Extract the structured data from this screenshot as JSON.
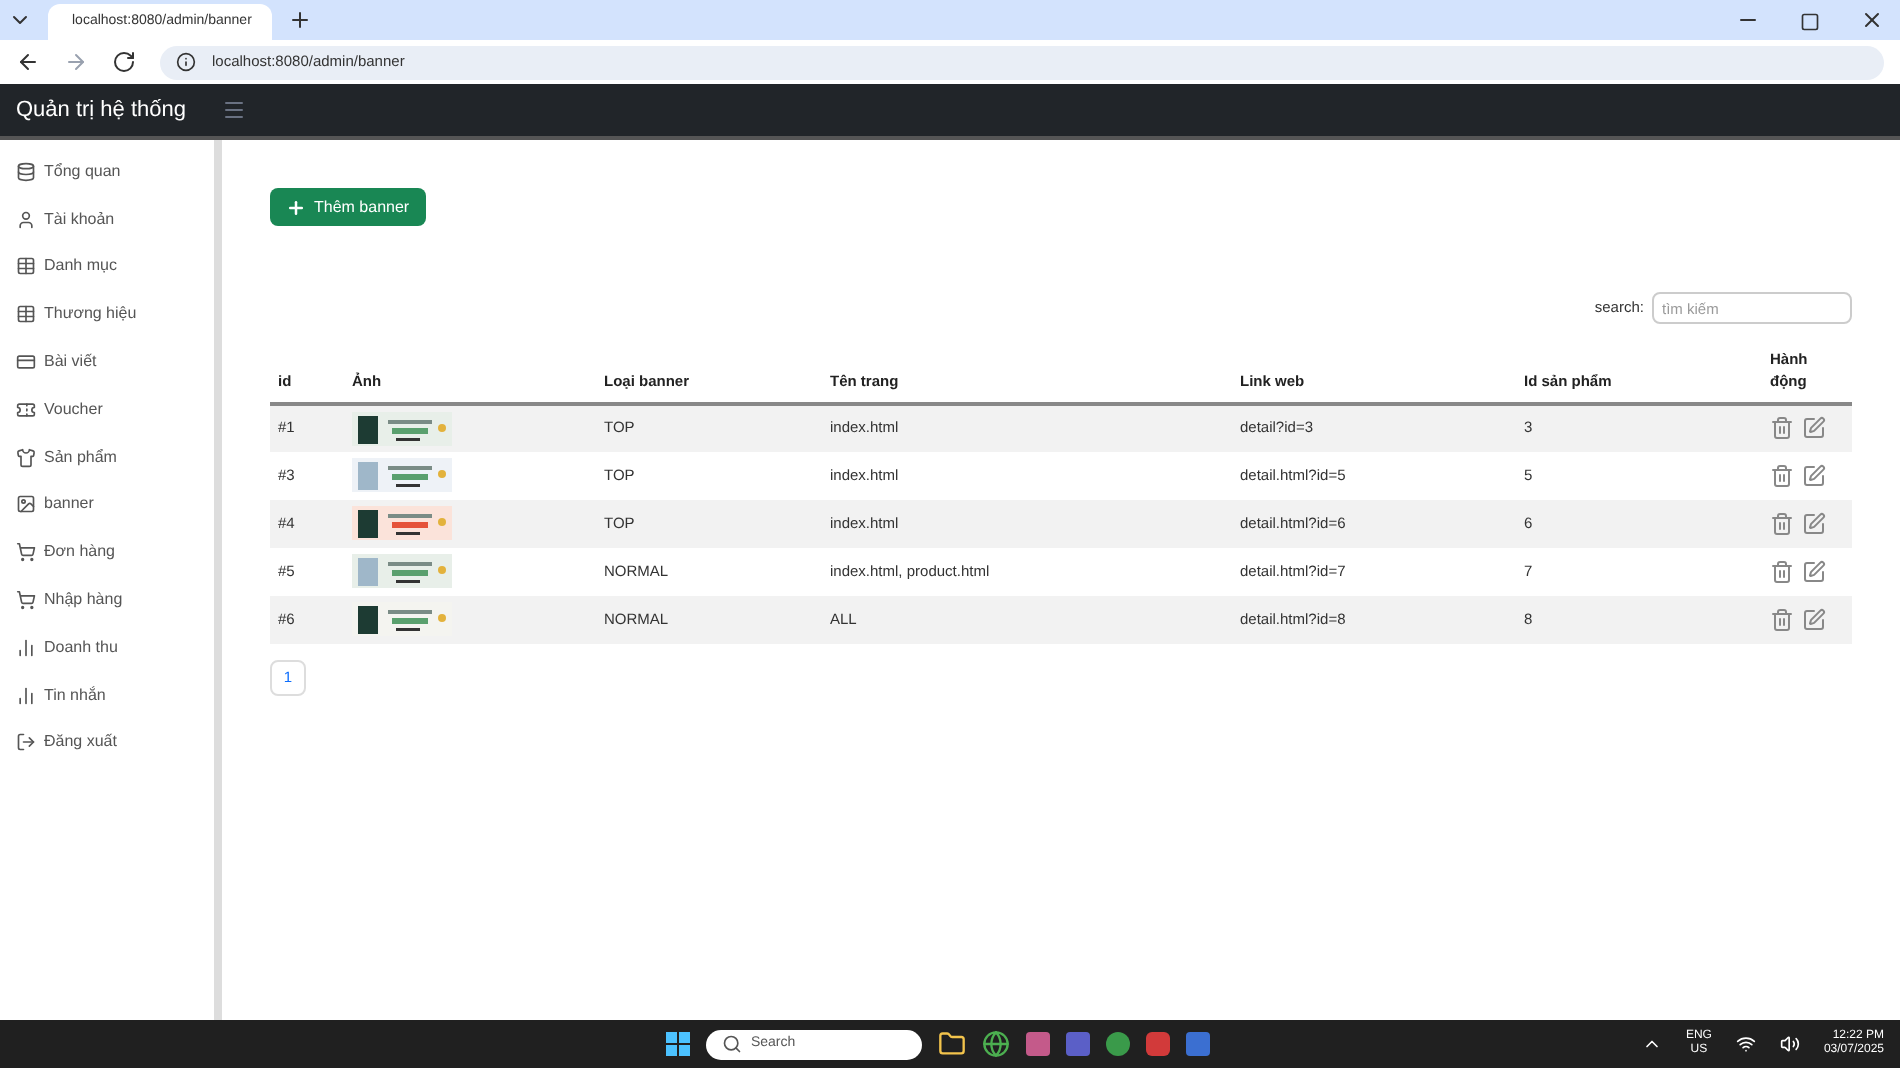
{
  "browser": {
    "tab_title": "localhost:8080/admin/banner",
    "url": "localhost:8080/admin/banner"
  },
  "navbar": {
    "brand": "Quản trị hệ thống"
  },
  "sidebar": {
    "items": [
      {
        "label": "Tổng quan"
      },
      {
        "label": "Tài khoản"
      },
      {
        "label": "Danh mục"
      },
      {
        "label": "Thương hiệu"
      },
      {
        "label": "Bài viết"
      },
      {
        "label": "Voucher"
      },
      {
        "label": "Sản phẩm"
      },
      {
        "label": "banner"
      },
      {
        "label": "Đơn hàng"
      },
      {
        "label": "Nhập hàng"
      },
      {
        "label": "Doanh thu"
      },
      {
        "label": "Tin nhắn"
      },
      {
        "label": "Đăng xuất"
      }
    ]
  },
  "add_button": "Thêm banner",
  "search": {
    "label": "search:",
    "placeholder": "tìm kiếm"
  },
  "table": {
    "columns": [
      "id",
      "Ảnh",
      "Loại banner",
      "Tên trang",
      "Link web",
      "Id sản phẩm",
      "Hành động"
    ],
    "rows": [
      {
        "id": "#1",
        "type": "TOP",
        "page": "index.html",
        "link": "detail?id=3",
        "product_id": "3"
      },
      {
        "id": "#3",
        "type": "TOP",
        "page": "index.html",
        "link": "detail.html?id=5",
        "product_id": "5"
      },
      {
        "id": "#4",
        "type": "TOP",
        "page": "index.html",
        "link": "detail.html?id=6",
        "product_id": "6"
      },
      {
        "id": "#5",
        "type": "NORMAL",
        "page": "index.html, product.html",
        "link": "detail.html?id=7",
        "product_id": "7"
      },
      {
        "id": "#6",
        "type": "NORMAL",
        "page": "ALL",
        "link": "detail.html?id=8",
        "product_id": "8"
      }
    ]
  },
  "pagination": [
    {
      "label": "1",
      "selected": false
    }
  ],
  "taskbar": {
    "search_placeholder": "Search",
    "language": "ENG",
    "region": "US",
    "time": "12:22 PM",
    "date": "03/07/2025"
  }
}
